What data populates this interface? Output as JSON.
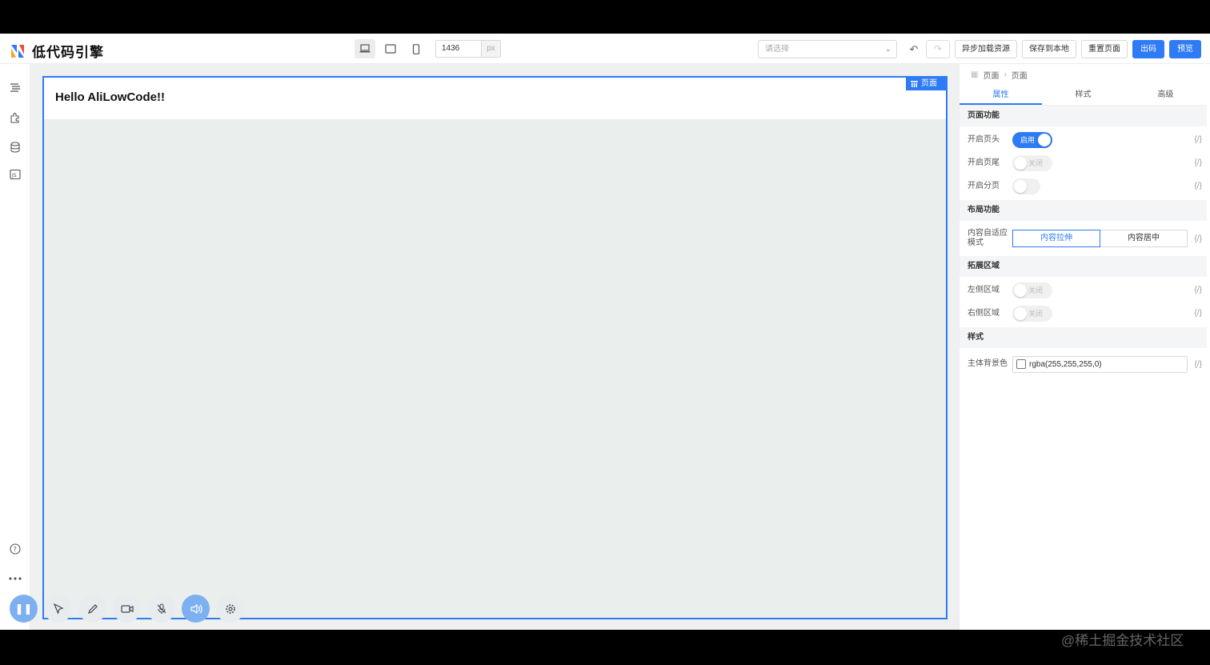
{
  "app": {
    "logo_text": "低代码引擎",
    "width_value": "1436",
    "width_unit": "px",
    "select_placeholder": "请选择",
    "buttons": {
      "async_load": "异步加载资源",
      "save_local": "保存到本地",
      "reset_page": "重置页面",
      "export_code": "出码",
      "preview": "预览"
    },
    "brand_color": "#2f7bf5"
  },
  "canvas": {
    "hello_text": "Hello AliLowCode!!",
    "page_tag": "页面"
  },
  "panel": {
    "breadcrumb": [
      "页面",
      "页面"
    ],
    "tabs": [
      "属性",
      "样式",
      "高级"
    ],
    "sections": {
      "page_features": "页面功能",
      "layout_features": "布局功能",
      "extend_area": "拓展区域",
      "style": "样式"
    },
    "rows": {
      "header_label": "开启页头",
      "header_state": "启用",
      "footer_label": "开启页尾",
      "footer_state": "关闭",
      "paging_label": "开启分页",
      "adapt_label": "内容自适应模式",
      "adapt_opt1": "内容拉伸",
      "adapt_opt2": "内容居中",
      "left_label": "左侧区域",
      "left_state": "关闭",
      "right_label": "右侧区域",
      "right_state": "关闭",
      "bg_label": "主体背景色",
      "bg_value": "rgba(255,255,255,0)"
    },
    "code_glyph": "{/}"
  },
  "watermark": "@稀土掘金技术社区"
}
